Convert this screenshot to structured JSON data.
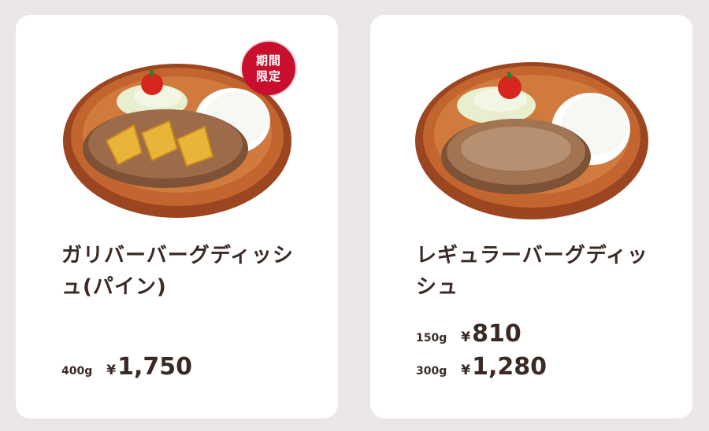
{
  "colors": {
    "background": "#ebe7e6",
    "card": "#ffffff",
    "text": "#3a2a26",
    "badge": "#c8102e",
    "plate": "#b5572c",
    "patty": "#8a5a3a",
    "rice": "#ffffff",
    "pineapple": "#e9b43a",
    "tomato": "#d6261d"
  },
  "items": [
    {
      "name": "ガリバーバーグディッシュ(パイン)",
      "badge": "期間限定",
      "image_icon": "hamburger-steak-pineapple-plate-icon",
      "prices": [
        {
          "weight": "400g",
          "currency": "¥",
          "amount": "1,750"
        }
      ]
    },
    {
      "name": "レギュラーバーグディッシュ",
      "image_icon": "hamburger-steak-plate-icon",
      "prices": [
        {
          "weight": "150g",
          "currency": "¥",
          "amount": "810"
        },
        {
          "weight": "300g",
          "currency": "¥",
          "amount": "1,280"
        }
      ]
    }
  ]
}
